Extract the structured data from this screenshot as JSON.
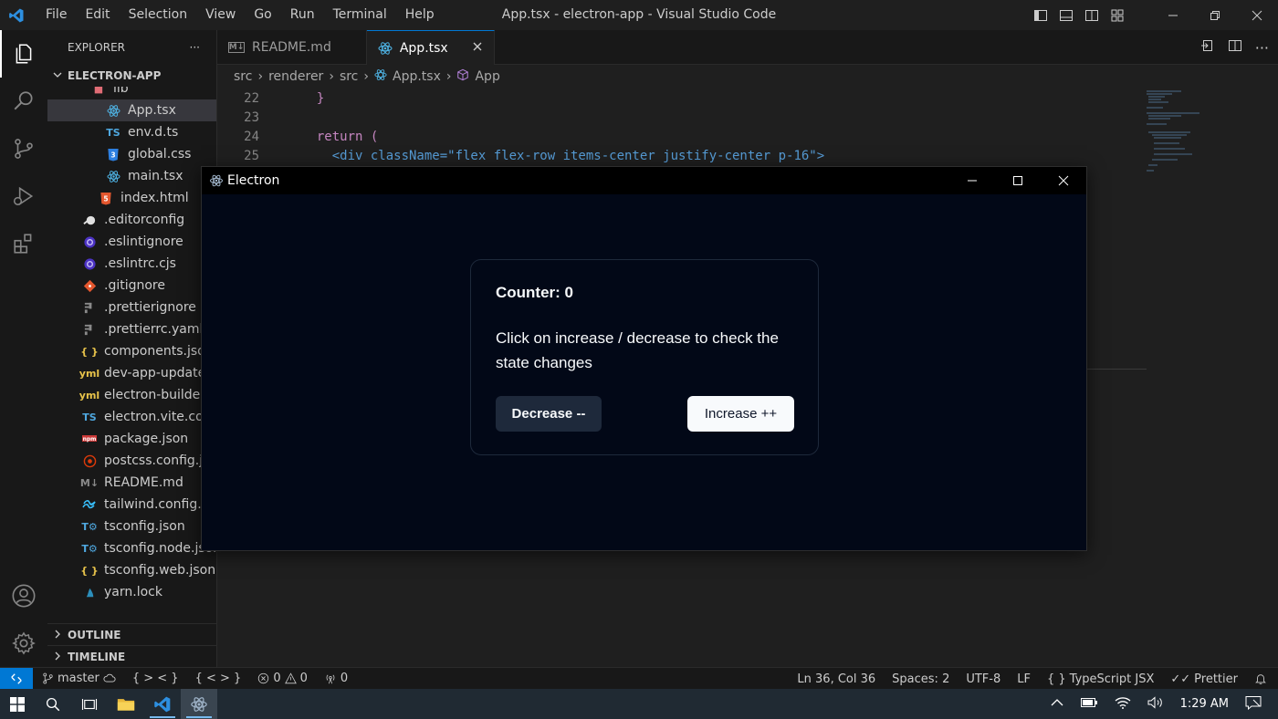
{
  "titlebar": {
    "menu": [
      "File",
      "Edit",
      "Selection",
      "View",
      "Go",
      "Run",
      "Terminal",
      "Help"
    ],
    "window_title": "App.tsx - electron-app - Visual Studio Code"
  },
  "sidebar": {
    "header": "EXPLORER",
    "more": "···",
    "project": "ELECTRON-APP",
    "partial_folder": "lib",
    "files": [
      {
        "name": "App.tsx",
        "icon": "react-icon",
        "indent": 2,
        "selected": true
      },
      {
        "name": "env.d.ts",
        "icon": "typescript-icon",
        "indent": 2
      },
      {
        "name": "global.css",
        "icon": "css-icon",
        "indent": 2
      },
      {
        "name": "main.tsx",
        "icon": "react-icon",
        "indent": 2
      },
      {
        "name": "index.html",
        "icon": "html-icon",
        "indent": 1
      },
      {
        "name": ".editorconfig",
        "icon": "editorconfig-icon",
        "indent": 0
      },
      {
        "name": ".eslintignore",
        "icon": "eslint-icon",
        "indent": 0
      },
      {
        "name": ".eslintrc.cjs",
        "icon": "eslint-icon",
        "indent": 0
      },
      {
        "name": ".gitignore",
        "icon": "git-icon",
        "indent": 0
      },
      {
        "name": ".prettierignore",
        "icon": "prettier-icon",
        "indent": 0
      },
      {
        "name": ".prettierrc.yaml",
        "icon": "prettier-icon",
        "indent": 0
      },
      {
        "name": "components.json",
        "icon": "json-icon",
        "indent": 0
      },
      {
        "name": "dev-app-update.yml",
        "icon": "yaml-icon",
        "indent": 0
      },
      {
        "name": "electron-builder.yml",
        "icon": "yaml-icon",
        "indent": 0
      },
      {
        "name": "electron.vite.config.ts",
        "icon": "typescript-icon",
        "indent": 0
      },
      {
        "name": "package.json",
        "icon": "npm-icon",
        "indent": 0
      },
      {
        "name": "postcss.config.js",
        "icon": "postcss-icon",
        "indent": 0
      },
      {
        "name": "README.md",
        "icon": "markdown-icon",
        "indent": 0
      },
      {
        "name": "tailwind.config.js",
        "icon": "tailwind-icon",
        "indent": 0
      },
      {
        "name": "tsconfig.json",
        "icon": "tsconfig-icon",
        "indent": 0
      },
      {
        "name": "tsconfig.node.json",
        "icon": "tsconfig-icon",
        "indent": 0
      },
      {
        "name": "tsconfig.web.json",
        "icon": "json-icon",
        "indent": 0
      },
      {
        "name": "yarn.lock",
        "icon": "yarn-icon",
        "indent": 0
      }
    ],
    "outline": "OUTLINE",
    "timeline": "TIMELINE"
  },
  "editor": {
    "tabs": [
      {
        "label": "README.md",
        "active": false
      },
      {
        "label": "App.tsx",
        "active": true
      }
    ],
    "breadcrumb": [
      "src",
      "renderer",
      "src",
      "App.tsx",
      "App"
    ],
    "lines": [
      {
        "n": "22",
        "text": "  }"
      },
      {
        "n": "23",
        "text": ""
      },
      {
        "n": "24",
        "text": "  return ("
      },
      {
        "n": "25",
        "text": "    <div className=\"flex flex-row items-center justify-center p-16\">"
      }
    ]
  },
  "electron": {
    "title": "Electron",
    "counter_label": "Counter: 0",
    "description": "Click on increase / decrease to check the state changes",
    "decrease_label": "Decrease --",
    "increase_label": "Increase ++"
  },
  "statusbar": {
    "branch": "master",
    "braces1": "{ > < }",
    "braces2": "{ < > }",
    "errors": "0",
    "warnings": "0",
    "ports": "0",
    "position": "Ln 36, Col 36",
    "spaces": "Spaces: 2",
    "encoding": "UTF-8",
    "eol": "LF",
    "language": "TypeScript JSX",
    "formatter": "Prettier"
  },
  "taskbar": {
    "time": "1:29 AM"
  },
  "colors": {
    "accent": "#0078d4",
    "electron_bg": "#020817",
    "card_border": "#1e293b"
  }
}
